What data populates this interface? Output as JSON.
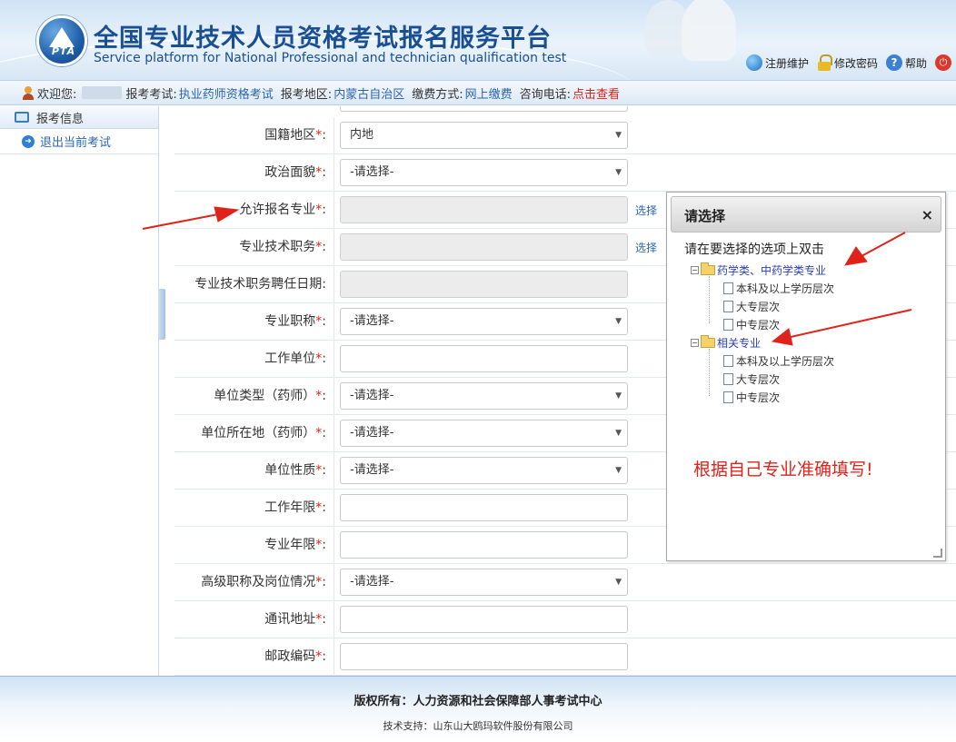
{
  "header": {
    "title_cn": "全国专业技术人员资格考试报名服务平台",
    "title_en": "Service platform for National Professional and technician qualification test",
    "logo_text": "PTA",
    "links": [
      {
        "label": "注册维护",
        "icon": "globe-icon"
      },
      {
        "label": "修改密码",
        "icon": "lock-icon"
      },
      {
        "label": "帮助",
        "icon": "help-icon"
      }
    ]
  },
  "infobar": {
    "welcome": "欢迎您:",
    "exam_label": "报考考试:",
    "exam_value": "执业药师资格考试",
    "region_label": "报考地区:",
    "region_value": "内蒙古自治区",
    "pay_label": "缴费方式:",
    "pay_value": "网上缴费",
    "phone_label": "咨询电话:",
    "phone_link": "点击查看"
  },
  "sidebar": {
    "header": "报考信息",
    "items": [
      {
        "label": "退出当前考试"
      }
    ]
  },
  "form": {
    "fields": [
      {
        "label": "国籍地区",
        "required": true,
        "type": "select",
        "value": "内地"
      },
      {
        "label": "政治面貌",
        "required": true,
        "type": "select",
        "value": "-请选择-"
      },
      {
        "label": "允许报名专业",
        "required": true,
        "type": "readonly",
        "value": "",
        "action": "选择"
      },
      {
        "label": "专业技术职务",
        "required": true,
        "type": "readonly",
        "value": "",
        "action": "选择"
      },
      {
        "label": "专业技术职务聘任日期",
        "required": false,
        "type": "readonly",
        "value": ""
      },
      {
        "label": "专业职称",
        "required": true,
        "type": "select",
        "value": "-请选择-"
      },
      {
        "label": "工作单位",
        "required": true,
        "type": "text",
        "value": ""
      },
      {
        "label": "单位类型（药师）",
        "required": true,
        "type": "select",
        "value": "-请选择-"
      },
      {
        "label": "单位所在地（药师）",
        "required": true,
        "type": "select",
        "value": "-请选择-"
      },
      {
        "label": "单位性质",
        "required": true,
        "type": "select",
        "value": "-请选择-"
      },
      {
        "label": "工作年限",
        "required": true,
        "type": "text",
        "value": ""
      },
      {
        "label": "专业年限",
        "required": true,
        "type": "text",
        "value": ""
      },
      {
        "label": "高级职称及岗位情况",
        "required": true,
        "type": "select",
        "value": "-请选择-"
      },
      {
        "label": "通讯地址",
        "required": true,
        "type": "text",
        "value": ""
      },
      {
        "label": "邮政编码",
        "required": true,
        "type": "text",
        "value": ""
      }
    ]
  },
  "dialog": {
    "title": "请选择",
    "close": "×",
    "hint": "请在要选择的选项上双击",
    "tree": [
      {
        "label": "药学类、中药学类专业",
        "children": [
          "本科及以上学历层次",
          "大专层次",
          "中专层次"
        ]
      },
      {
        "label": "相关专业",
        "children": [
          "本科及以上学历层次",
          "大专层次",
          "中专层次"
        ]
      }
    ],
    "note": "根据自己专业准确填写!"
  },
  "footer": {
    "copyright": "版权所有：人力资源和社会保障部人事考试中心",
    "tech_support": "技术支持：山东山大鸥玛软件股份有限公司"
  },
  "colors": {
    "brand_blue": "#1a4f93",
    "link_blue": "#2a66b3",
    "required_red": "#e0221a"
  }
}
